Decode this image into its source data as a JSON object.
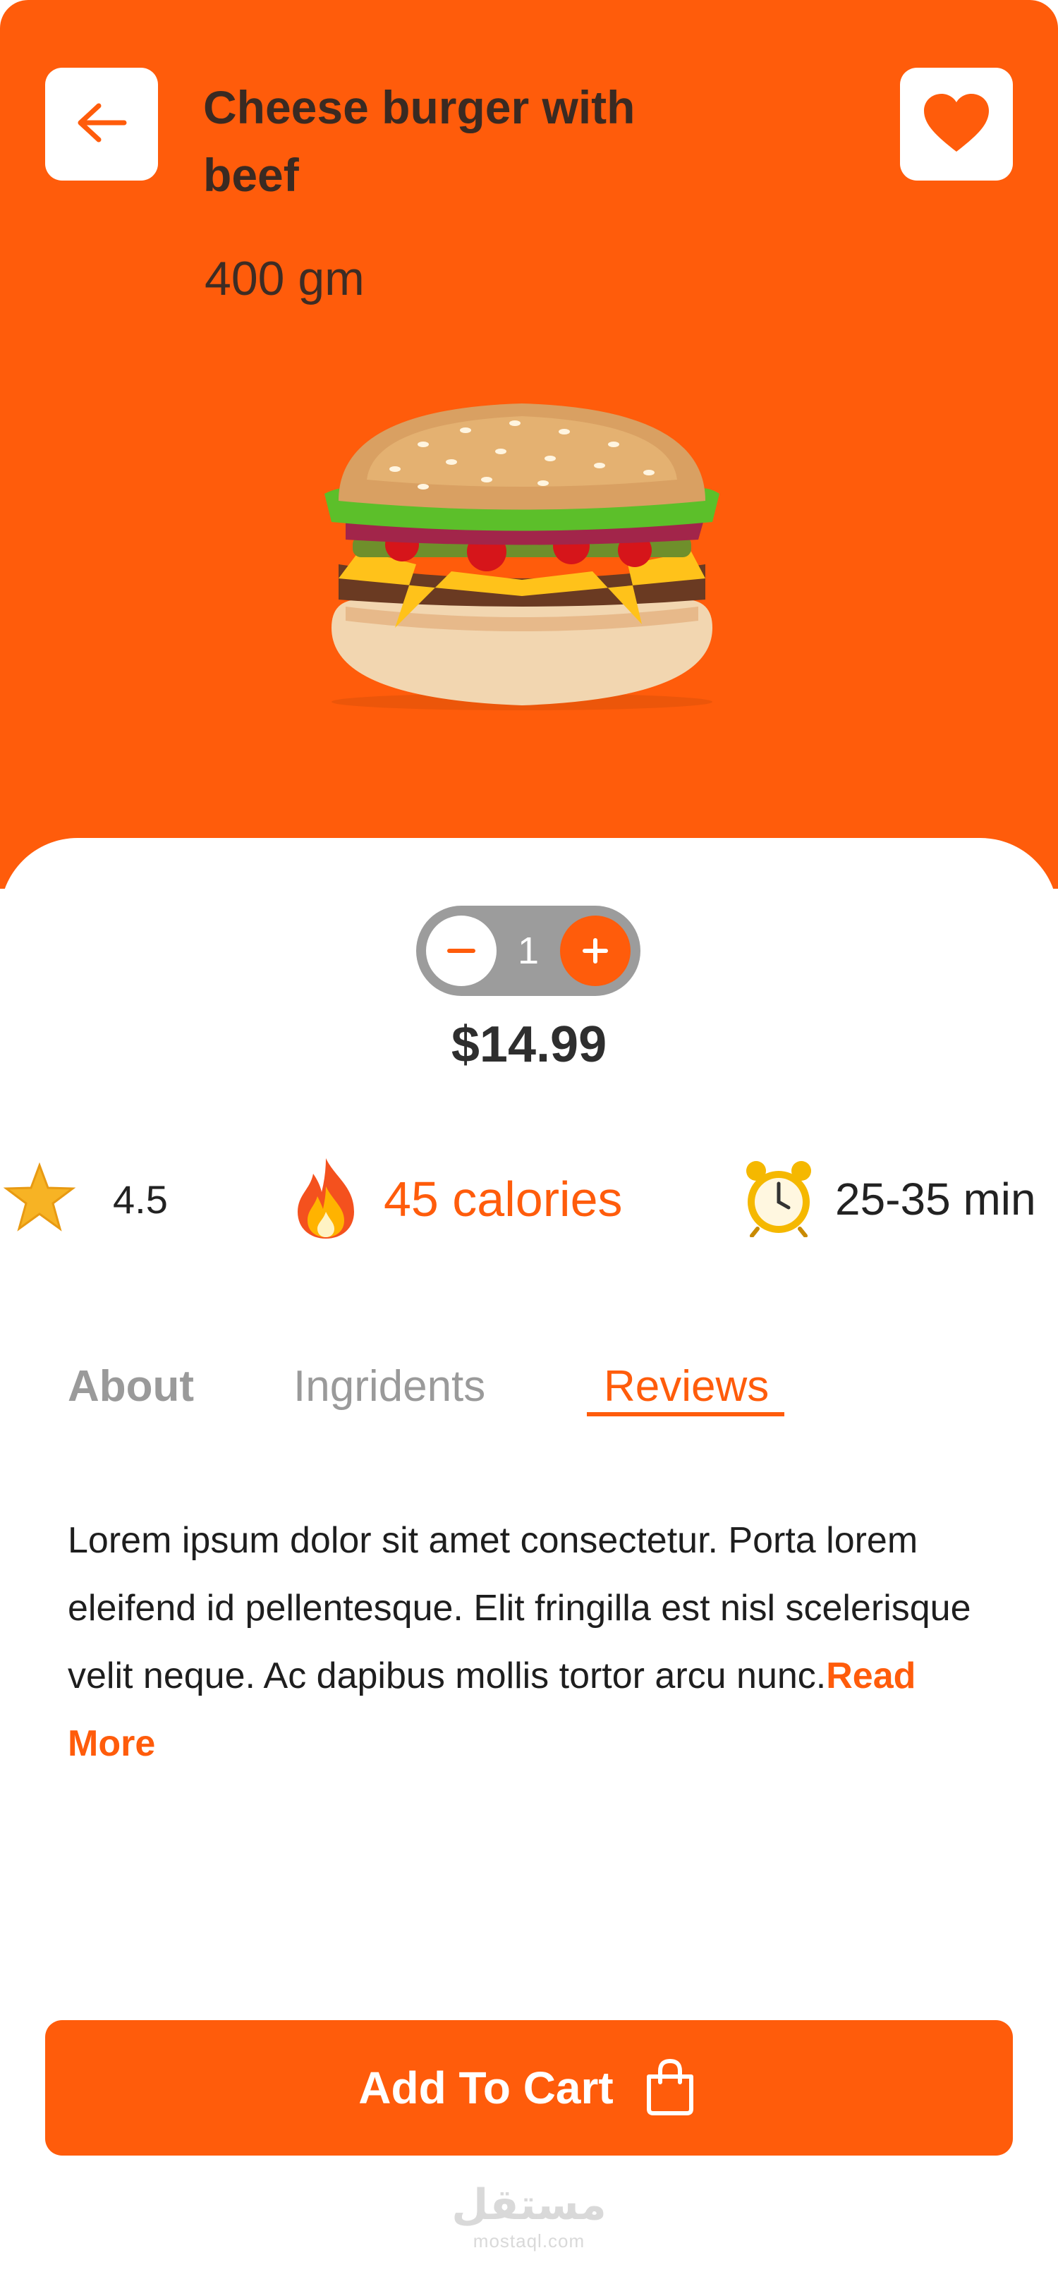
{
  "header": {
    "title": "Cheese burger with beef",
    "weight": "400 gm",
    "back_icon": "arrow-left-icon",
    "favorite_icon": "heart-icon"
  },
  "product": {
    "image": "cheeseburger-photo"
  },
  "quantity": {
    "value": "1",
    "decrement": "−",
    "increment": "+"
  },
  "price": "$14.99",
  "stats": {
    "rating": "4.5",
    "calories": "45 calories",
    "time": "25-35 min"
  },
  "tabs": {
    "about": "About",
    "ingredients": "Ingridents",
    "reviews": "Reviews",
    "active": "Reviews"
  },
  "description": {
    "text": "Lorem ipsum dolor sit amet consectetur. Porta lorem eleifend id pellentesque. Elit fringilla est nisl scelerisque velit neque. Ac dapibus mollis tortor arcu nunc.",
    "read_more": "Read More"
  },
  "cta": {
    "label": "Add To Cart",
    "icon": "shopping-bag-icon"
  },
  "watermark": {
    "arabic": "مستقل",
    "latin": "mostaql.com"
  },
  "colors": {
    "accent": "#FF5C0B",
    "text": "#333333",
    "stepper": "#9C9C9C"
  }
}
